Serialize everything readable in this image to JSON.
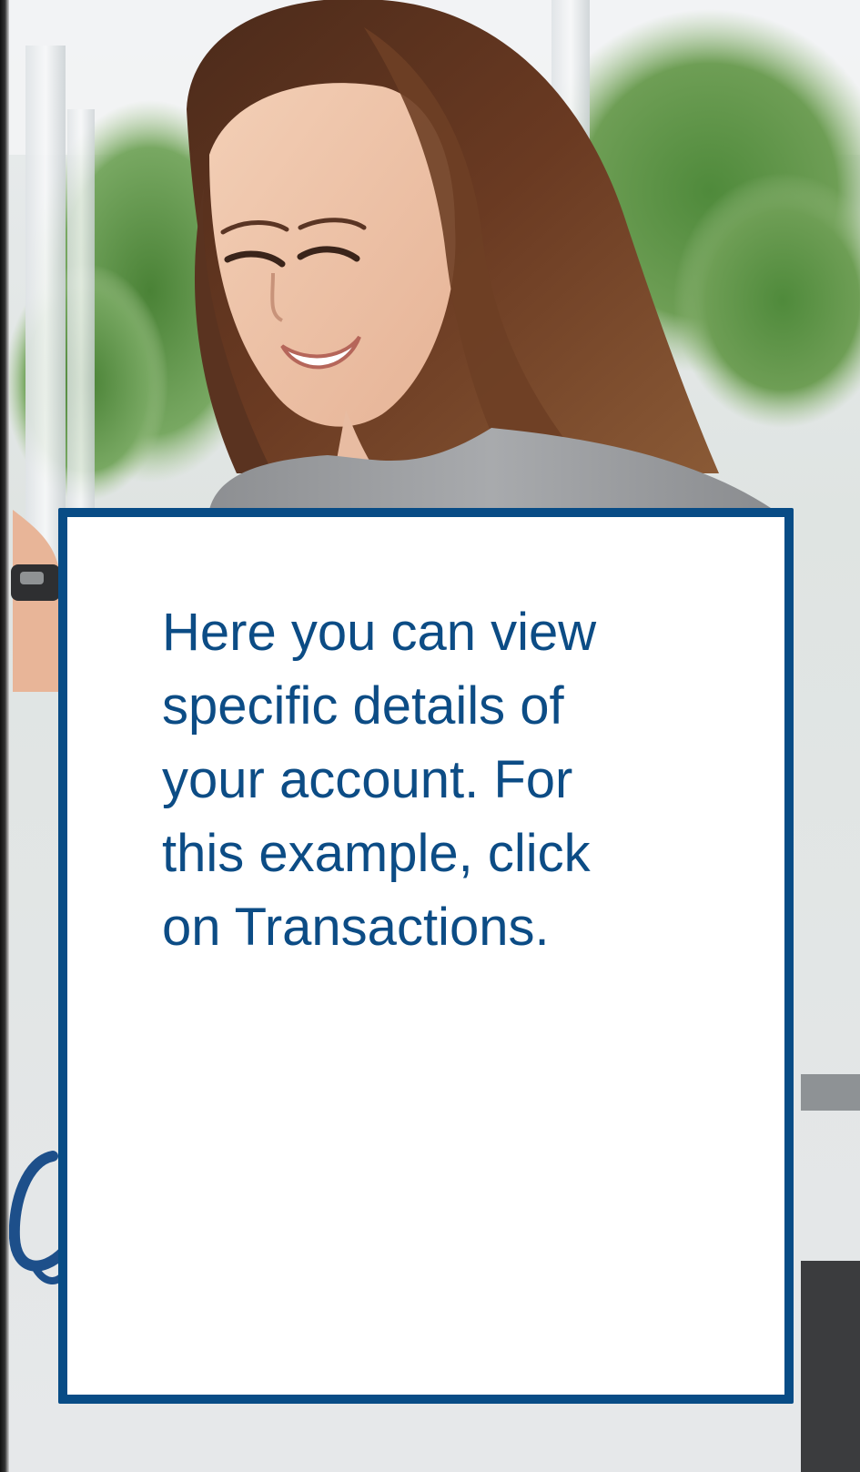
{
  "callout": {
    "text": "Here you can view\nspecific details of\nyour account.  For\nthis example, click\non Transactions."
  },
  "colors": {
    "accent": "#084C86",
    "text": "#0C4C85",
    "background": "#FFFFFF"
  },
  "hero": {
    "subject": "woman-smiling-at-phone-photo"
  }
}
